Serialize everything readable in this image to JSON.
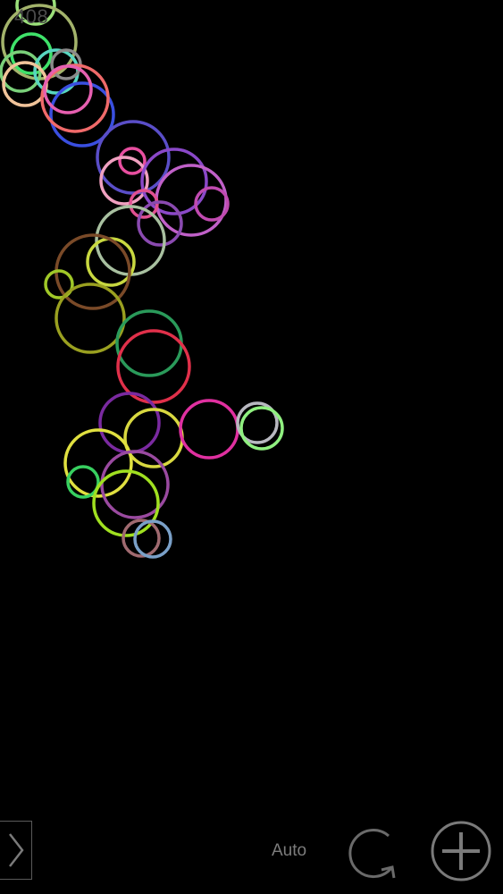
{
  "game": {
    "score": "408",
    "colors": {
      "background": "#000000",
      "hud_text": "#4a4a4a",
      "control": "#7a7a7a"
    }
  },
  "toolbar": {
    "auto_label": "Auto",
    "next_icon": "chevron-right-icon",
    "restart_icon": "refresh-icon",
    "add_icon": "plus-icon"
  }
}
